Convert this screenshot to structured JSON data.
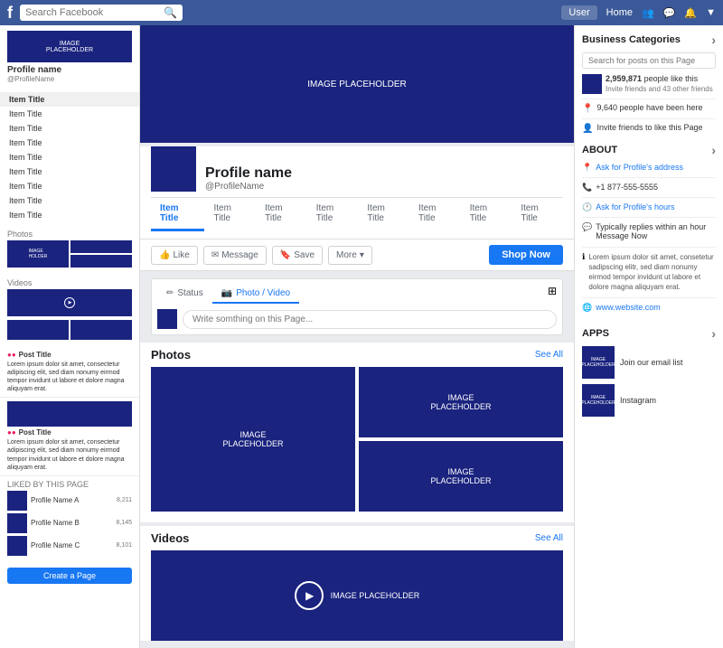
{
  "nav": {
    "logo": "f",
    "search_placeholder": "Search Facebook",
    "user_label": "User",
    "home_label": "Home"
  },
  "left_sidebar": {
    "cover_text": "IMAGE\nPLACEHOLDER",
    "profile_name": "Profile name",
    "profile_sub": "@ProfileName",
    "nav_items": [
      {
        "label": "Item Title",
        "active": true
      },
      {
        "label": "Item Title"
      },
      {
        "label": "Item Title"
      },
      {
        "label": "Item Title"
      },
      {
        "label": "Item Title"
      },
      {
        "label": "Item Title"
      },
      {
        "label": "Item Title"
      },
      {
        "label": "Item Title"
      },
      {
        "label": "Item Title"
      }
    ],
    "create_page_btn": "Create a Page",
    "photos_label": "Photos",
    "video_section_label": "Videos",
    "feed_items": [
      {
        "title": "Post Title",
        "text": "Lorem ipsum dolor sit amet, consectetur adipiscing elit, sed diam nonumy eirmod tempor invidunt ut labore et dolore magna aliquyam erat.",
        "meta": ""
      },
      {
        "title": "Post Title",
        "text": "Lorem ipsum dolor sit amet, consectetur adipiscing elit, sed diam nonumy eirmod tempor invidunt ut labore et dolore magna aliquyam erat.",
        "meta": ""
      }
    ],
    "likes_section_label": "LIKED BY THIS PAGE",
    "like_items": [
      {
        "name": "Profile Name A",
        "count": "8,211"
      },
      {
        "name": "Profile Name B",
        "count": "8,145"
      },
      {
        "name": "Profile Name C",
        "count": "8,101"
      }
    ]
  },
  "profile": {
    "cover_text": "IMAGE PLACEHOLDER",
    "name": "Profile name",
    "handle": "@ProfileName",
    "nav_items": [
      "Item Title",
      "Item Title",
      "Item Title",
      "Item Title",
      "Item Title",
      "Item Title",
      "Item Title",
      "Item Title"
    ]
  },
  "action_bar": {
    "like_btn": "Like",
    "message_btn": "Message",
    "save_btn": "Save",
    "more_btn": "More",
    "shop_now_btn": "Shop Now"
  },
  "composer": {
    "status_tab": "Status",
    "photo_video_tab": "Photo / Video",
    "placeholder": "Write somthing on this Page...",
    "opt1": "⋮"
  },
  "photos_section": {
    "title": "Photos",
    "see_all": "See All",
    "placeholder_text": "IMAGE\nPLACEHOLDER"
  },
  "videos_section": {
    "title": "Videos",
    "see_all": "See All",
    "placeholder_text": "IMAGE PLACEHOLDER"
  },
  "right_sidebar": {
    "biz_categories_title": "Business Categories",
    "biz_search_placeholder": "Search for posts on this Page",
    "people_count": "2,959,871",
    "people_label": "people like this",
    "people_sub": "Invite friends and 43 other friends",
    "been_here_count": "9,640 people have been here",
    "invite_label": "Invite friends to like this Page",
    "about_title": "ABOUT",
    "about_address_label": "Ask for Profile's address",
    "about_phone": "+1 877-555-5555",
    "about_hours_label": "Ask for Profile's hours",
    "about_response": "Typically replies within an hour",
    "about_message_link": "Message Now",
    "about_desc": "Lorem ipsum dolor sit amet, consetetur sadipscing elitr, sed diam nonumy eirmod tempor invidunt ut labore et dolore magna aliquyam erat.",
    "about_website": "www.website.com",
    "apps_title": "APPS",
    "apps": [
      {
        "label": "Join our email list",
        "thumb_text": "IMAGE\nPLACEHOLDER"
      },
      {
        "label": "Instagram",
        "thumb_text": "IMAGE\nPLACEHOLDER"
      }
    ]
  }
}
